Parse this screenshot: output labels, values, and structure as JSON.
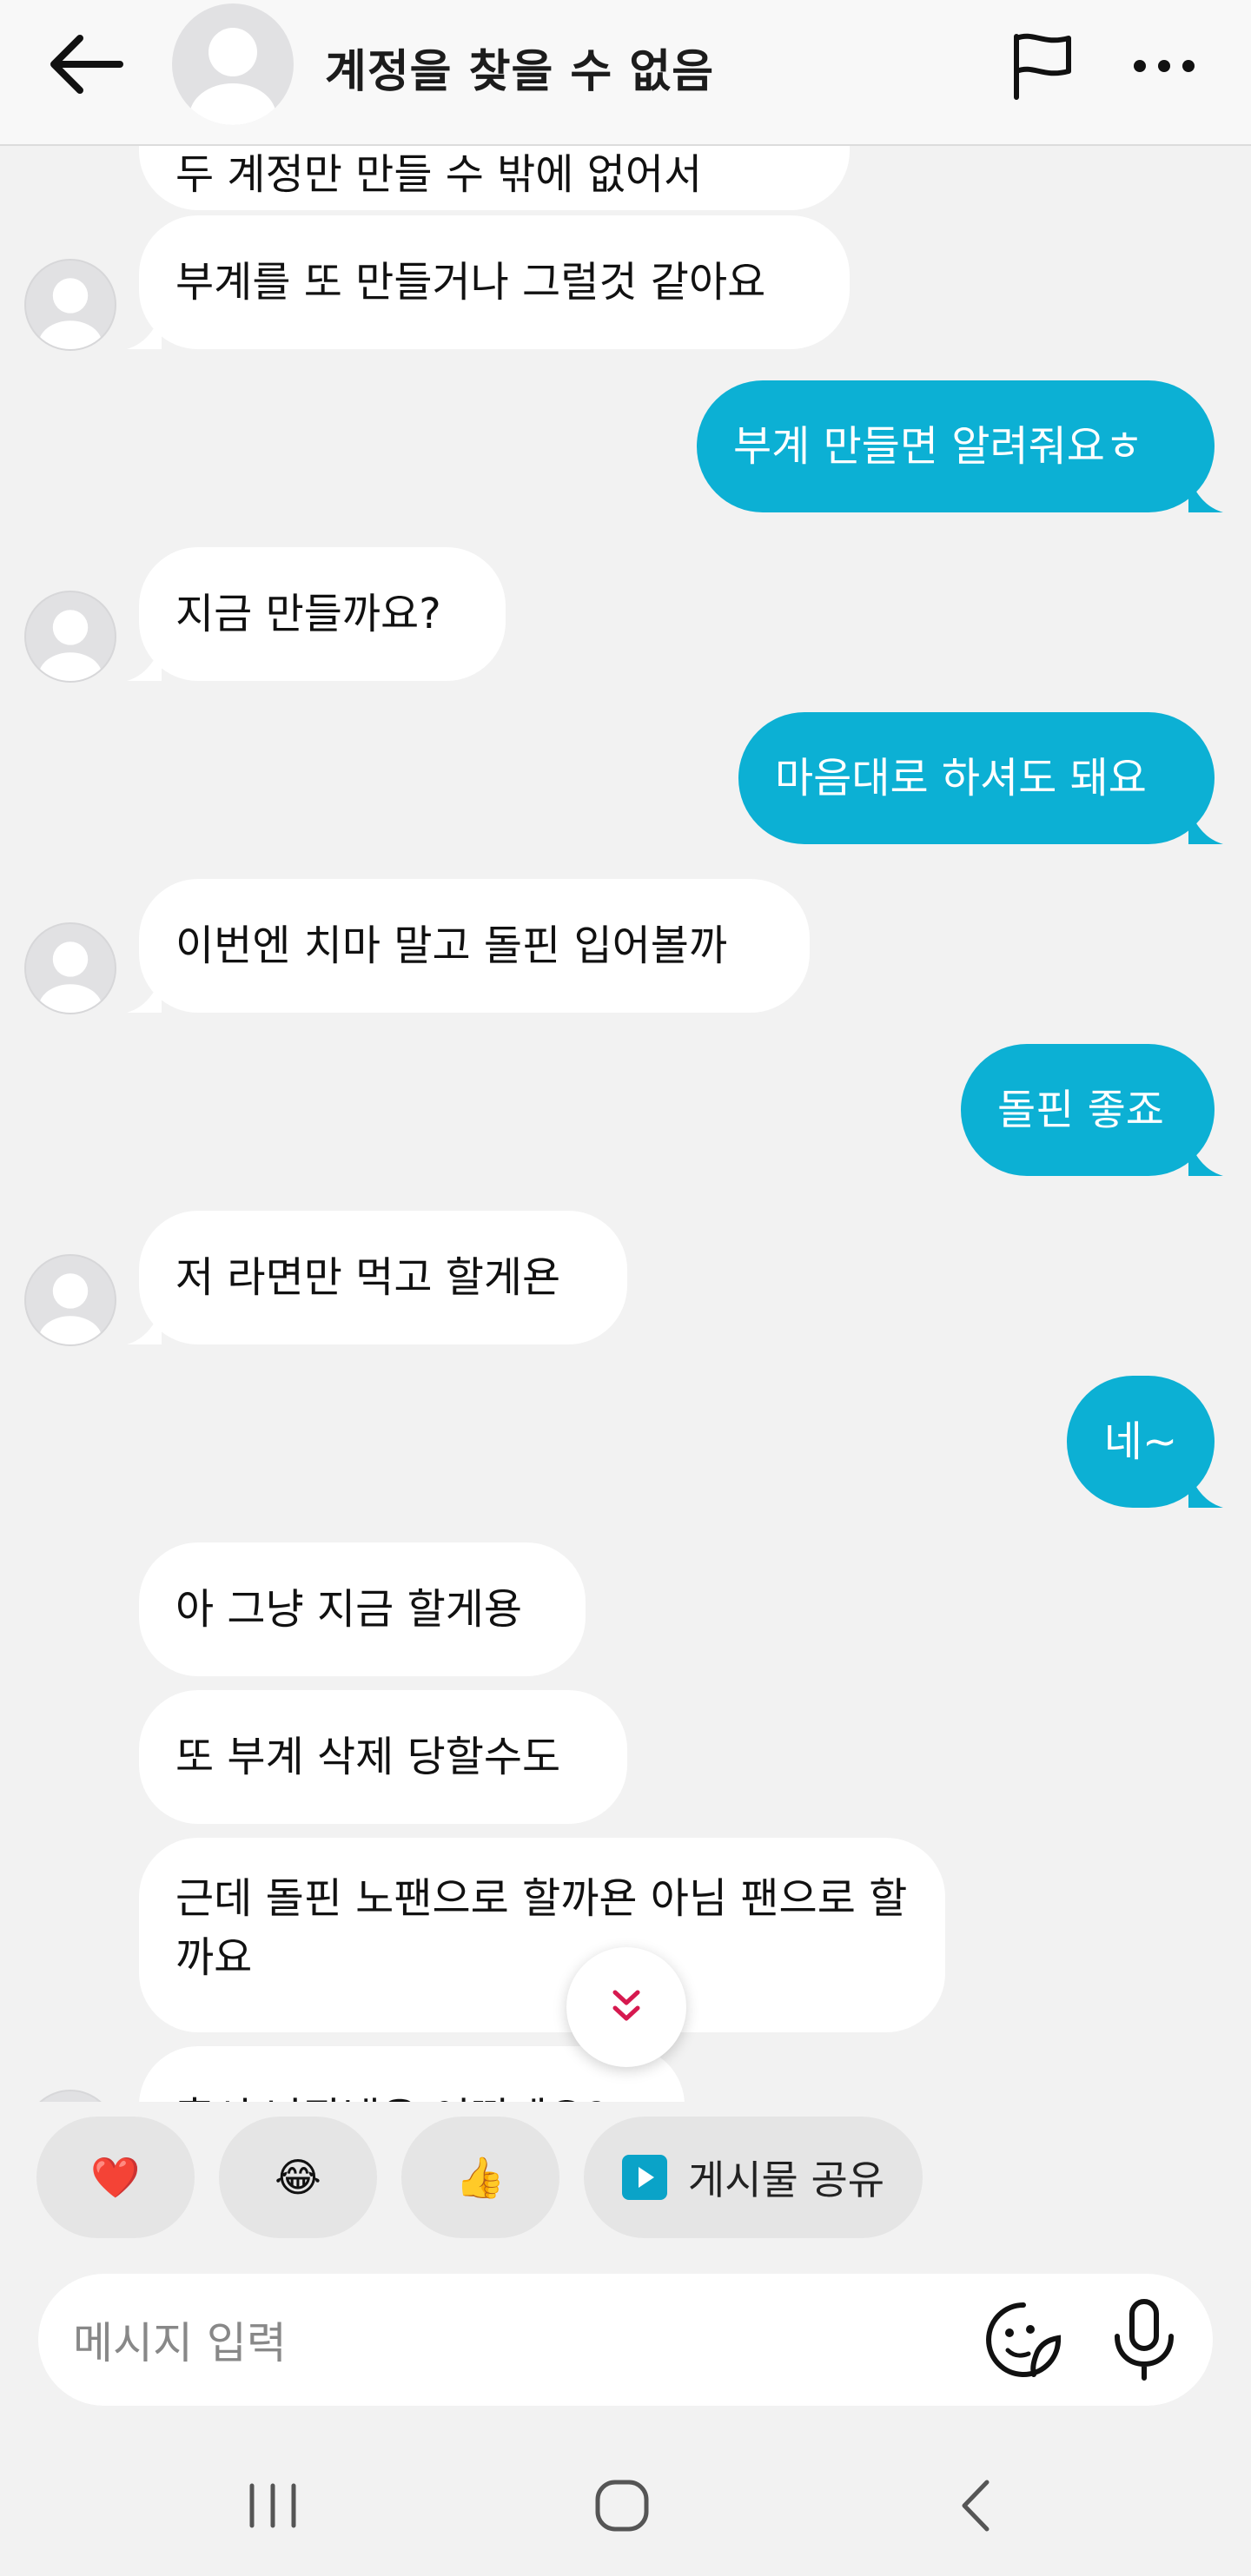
{
  "header": {
    "title": "계정을 찾을 수 없음"
  },
  "messages": [
    {
      "side": "in",
      "text": "두 계정만 만들 수 밖에 없어서"
    },
    {
      "side": "in",
      "text": "부계를 또 만들거나 그럴것 같아요"
    },
    {
      "side": "out",
      "text": "부계 만들면 알려줘요ㅎ"
    },
    {
      "side": "in",
      "text": "지금 만들까요?"
    },
    {
      "side": "out",
      "text": "마음대로 하셔도 돼요"
    },
    {
      "side": "in",
      "text": "이번엔 치마 말고 돌핀 입어볼까"
    },
    {
      "side": "out",
      "text": "돌핀 좋죠"
    },
    {
      "side": "in",
      "text": "저 라면만 먹고 할게욘"
    },
    {
      "side": "out",
      "text": "네~"
    },
    {
      "side": "in",
      "text": "아 그냥 지금 할게용"
    },
    {
      "side": "in",
      "text": "또 부계 삭제 당할수도"
    },
    {
      "side": "in",
      "text": "근데 돌핀 노팬으로 할까욘 아님 팬으로 할까요"
    },
    {
      "side": "in",
      "text": "혹시 난장냄은 어떤데요?"
    }
  ],
  "quick_reactions": {
    "heart": "❤️",
    "laugh": "😂",
    "thumbs": "👍",
    "share_label": "게시물 공유"
  },
  "composer": {
    "placeholder": "메시지 입력"
  },
  "colors": {
    "outgoing_bubble": "#0cb0d4",
    "incoming_bubble": "#ffffff",
    "background": "#f2f2f2",
    "scroll_arrow": "#d6194f"
  },
  "icons": [
    "back-arrow-icon",
    "flag-icon",
    "more-icon",
    "avatar-placeholder-icon",
    "scroll-down-icon",
    "play-icon",
    "sticker-icon",
    "mic-icon",
    "recent-apps-icon",
    "home-icon",
    "nav-back-icon"
  ]
}
